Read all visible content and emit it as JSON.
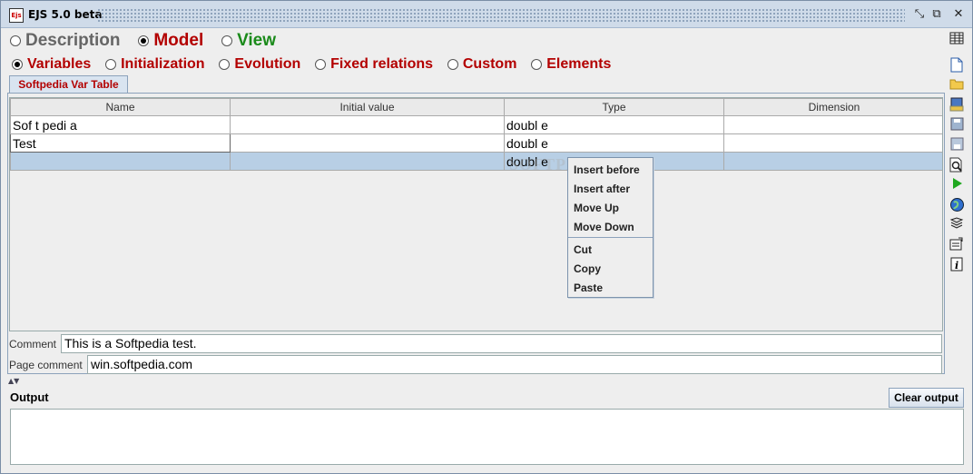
{
  "window": {
    "title": "EJS 5.0 beta",
    "app_icon_text": "Ejs"
  },
  "main_radios": [
    {
      "label": "Description",
      "selected": false,
      "color": "#666666"
    },
    {
      "label": "Model",
      "selected": true,
      "color": "#b30000"
    },
    {
      "label": "View",
      "selected": false,
      "color": "#1a8a1a"
    }
  ],
  "sub_radios": [
    {
      "label": "Variables",
      "selected": true
    },
    {
      "label": "Initialization",
      "selected": false
    },
    {
      "label": "Evolution",
      "selected": false
    },
    {
      "label": "Fixed relations",
      "selected": false
    },
    {
      "label": "Custom",
      "selected": false
    },
    {
      "label": "Elements",
      "selected": false
    }
  ],
  "tab": {
    "label": "Softpedia Var Table"
  },
  "table": {
    "columns": [
      "Name",
      "Initial value",
      "Type",
      "Dimension"
    ],
    "rows": [
      {
        "name": "Sof t pedi a",
        "initial": "",
        "type": "doubl e",
        "dimension": ""
      },
      {
        "name": "Test",
        "initial": "",
        "type": "doubl e",
        "dimension": ""
      },
      {
        "name": "",
        "initial": "",
        "type": "doubl e",
        "dimension": ""
      }
    ]
  },
  "comments": {
    "comment_label": "Comment",
    "comment_value": "This is a Softpedia test.",
    "page_comment_label": "Page comment",
    "page_comment_value": "win.softpedia.com"
  },
  "output": {
    "label": "Output",
    "clear_button": "Clear output",
    "content": ""
  },
  "context_menu": {
    "items_group1": [
      "Insert before",
      "Insert after",
      "Move Up",
      "Move Down"
    ],
    "items_group2": [
      "Cut",
      "Copy",
      "Paste"
    ]
  },
  "watermark": "SOFTPEDIA",
  "colors": {
    "accent_red": "#b30000",
    "view_green": "#1a8a1a",
    "selected_row": "#b8cfe5",
    "titlebar": "#cfdbe9"
  },
  "right_toolbar_icons": [
    "table-options-icon",
    "new-file-icon",
    "open-folder-icon",
    "save-icon",
    "save-as-icon",
    "search-icon",
    "run-icon",
    "web-icon",
    "layers-icon",
    "edit-options-icon",
    "info-icon"
  ]
}
